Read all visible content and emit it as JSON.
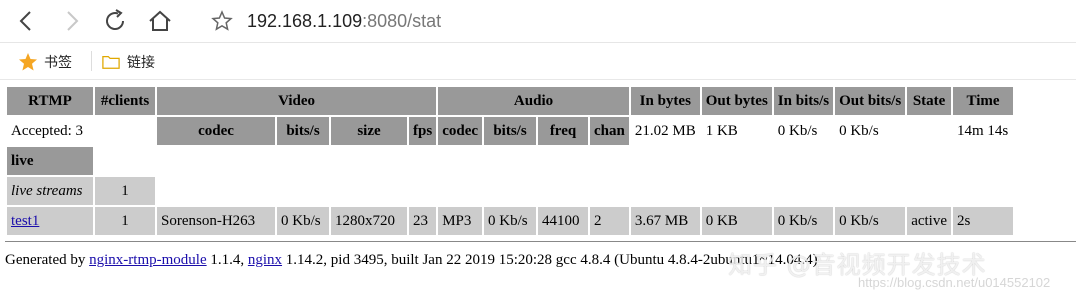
{
  "browser": {
    "url_host": "192.168.1.109",
    "url_rest": ":8080/stat",
    "icons": [
      "back-icon",
      "forward-icon",
      "reload-icon",
      "home-icon",
      "star-icon"
    ]
  },
  "bookmarks": [
    {
      "label": "书签",
      "icon": "star-icon"
    },
    {
      "label": "链接",
      "icon": "folder-icon"
    }
  ],
  "colors": {
    "header_bg": "#999999",
    "row_bg": "#cccccc",
    "link": "#1a0dab",
    "star": "#f5a623",
    "folder": "#f2c94c"
  },
  "stat": {
    "headers": {
      "rtmp": "RTMP",
      "clients": "#clients",
      "video": "Video",
      "audio": "Audio",
      "in_bytes": "In bytes",
      "out_bytes": "Out bytes",
      "in_bits": "In bits/s",
      "out_bits": "Out bits/s",
      "state": "State",
      "time": "Time"
    },
    "subheaders": {
      "v_codec": "codec",
      "v_bits": "bits/s",
      "v_size": "size",
      "v_fps": "fps",
      "a_codec": "codec",
      "a_bits": "bits/s",
      "a_freq": "freq",
      "a_chan": "chan"
    },
    "accepted": "Accepted: 3",
    "server": {
      "in_bytes": "21.02 MB",
      "out_bytes": "1 KB",
      "in_bits": "0 Kb/s",
      "out_bits": "0 Kb/s",
      "time": "14m 14s"
    },
    "app_name": "live",
    "live_streams_label": "live streams",
    "live_streams_count": "1",
    "stream": {
      "name": "test1",
      "clients": "1",
      "v_codec": "Sorenson-H263",
      "v_bits": "0 Kb/s",
      "v_size": "1280x720",
      "v_fps": "23",
      "a_codec": "MP3",
      "a_bits": "0 Kb/s",
      "a_freq": "44100",
      "a_chan": "2",
      "in_bytes": "3.67 MB",
      "out_bytes": "0 KB",
      "in_bits": "0 Kb/s",
      "out_bits": "0 Kb/s",
      "state": "active",
      "time": "2s"
    }
  },
  "footer": {
    "prefix": "Generated by ",
    "module_link": "nginx-rtmp-module",
    "module_version": " 1.1.4, ",
    "nginx_link": "nginx",
    "rest": " 1.14.2, pid 3495, built Jan 22 2019 15:20:28 gcc 4.8.4 (Ubuntu 4.8.4-2ubuntu1~14.04.4)"
  },
  "watermark": {
    "main": "知乎 @音视频开发技术",
    "url": "https://blog.csdn.net/u014552102"
  }
}
